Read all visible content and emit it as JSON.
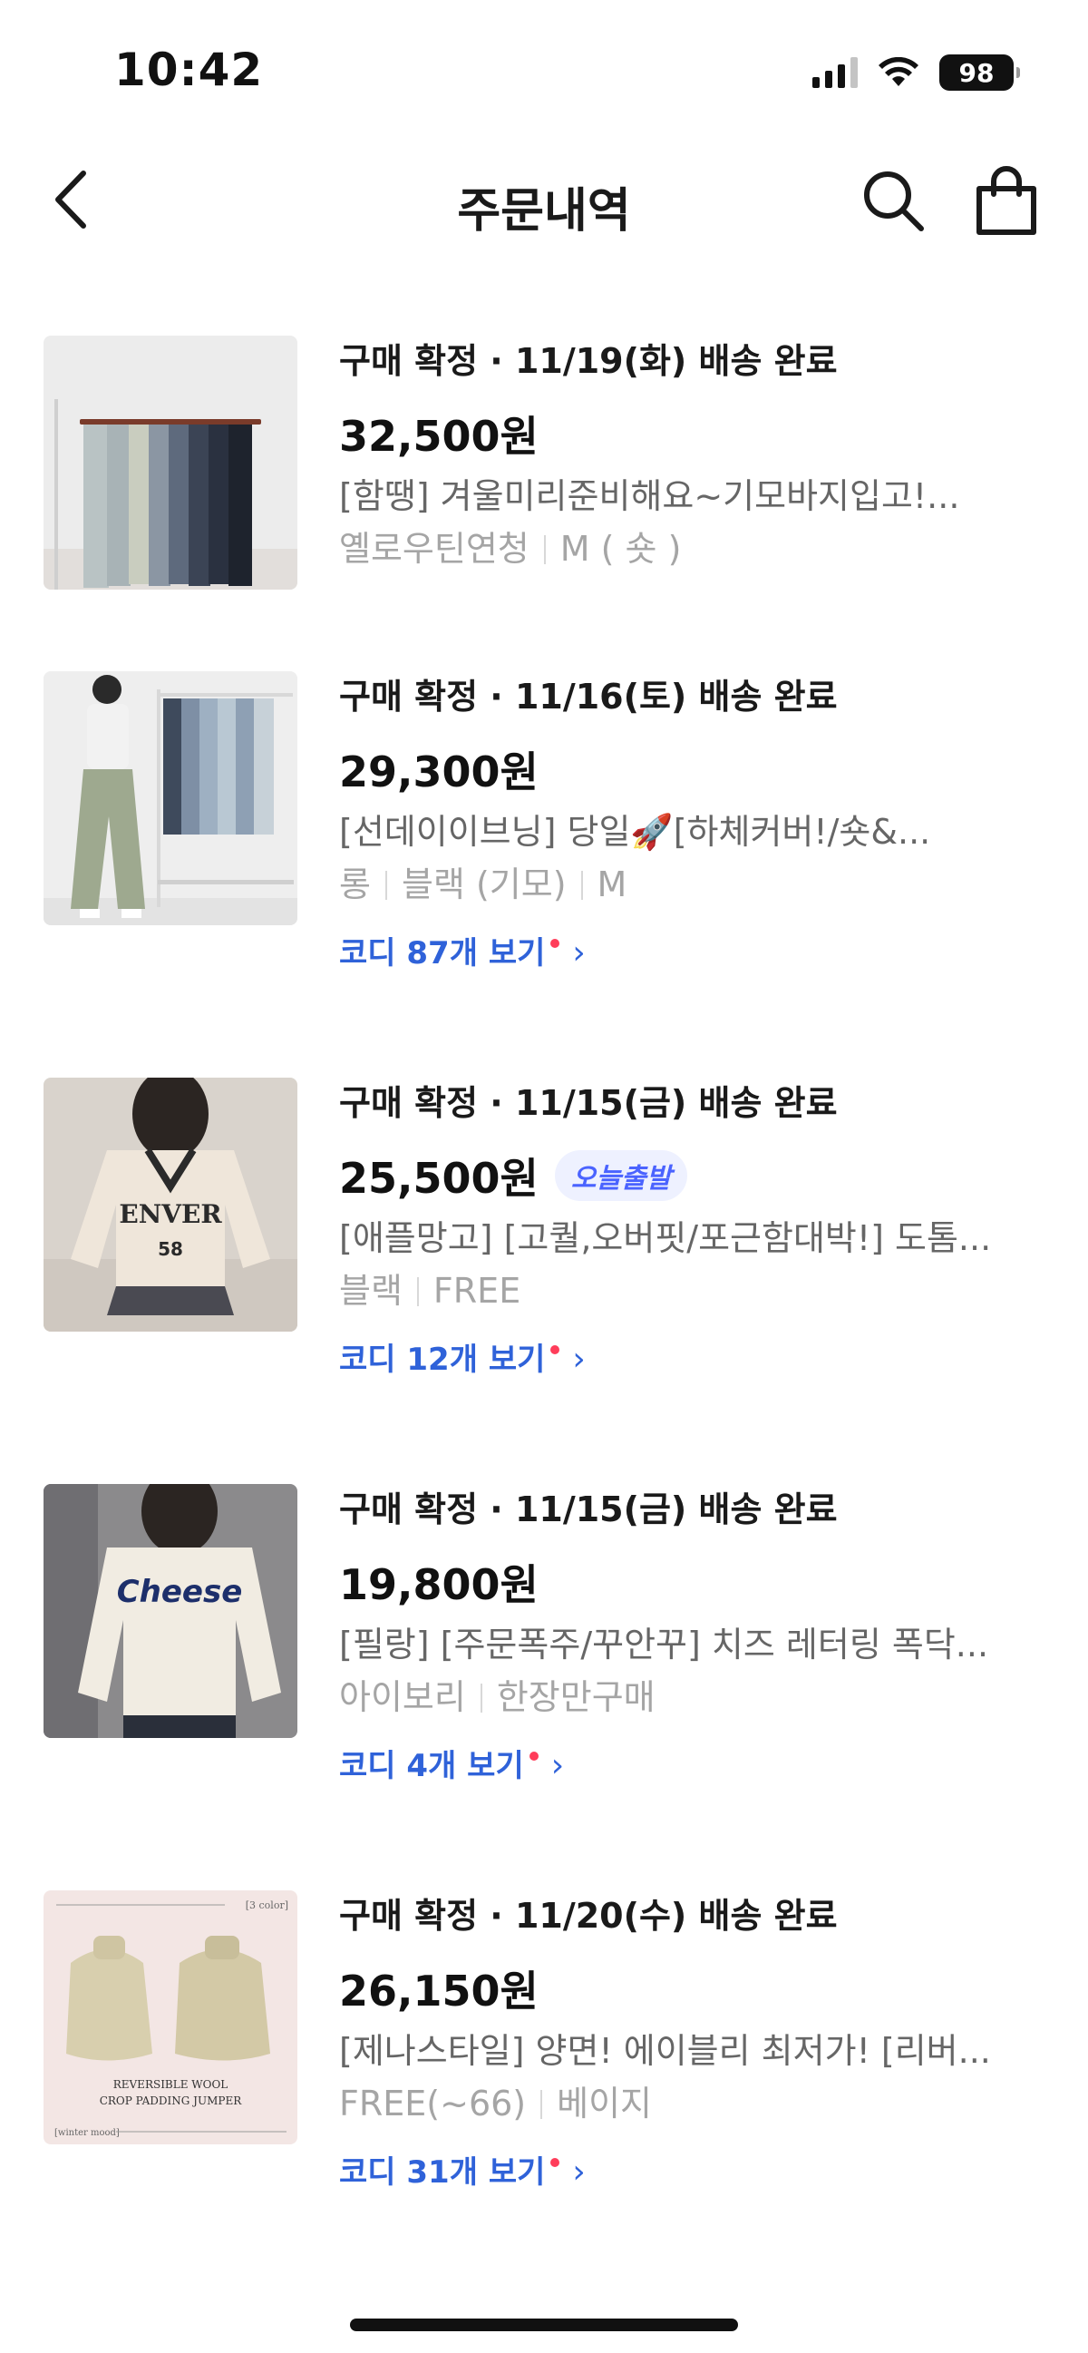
{
  "status_bar": {
    "time": "10:42",
    "battery": "98"
  },
  "nav": {
    "title": "주문내역"
  },
  "orders": [
    {
      "status": "구매 확정 · 11/19(화) 배송 완료",
      "price": "32,500원",
      "badge": "",
      "name": "[함땡] 겨울미리준비해요~기모바지입고!...",
      "options": [
        "옐로우틴연청",
        "M ( 숏 )"
      ],
      "codi": ""
    },
    {
      "status": "구매 확정 · 11/16(토) 배송 완료",
      "price": "29,300원",
      "badge": "",
      "name": "[선데이이브닝] 당일🚀[하체커버!/숏&...",
      "options": [
        "롱",
        "블랙 (기모)",
        "M"
      ],
      "codi": "코디 87개 보기"
    },
    {
      "status": "구매 확정 · 11/15(금) 배송 완료",
      "price": "25,500원",
      "badge": "오늘출발",
      "name": "[애플망고] [고퀄,오버핏/포근함대박!] 도톰...",
      "options": [
        "블랙",
        "FREE"
      ],
      "codi": "코디 12개 보기"
    },
    {
      "status": "구매 확정 · 11/15(금) 배송 완료",
      "price": "19,800원",
      "badge": "",
      "name": "[필랑] [주문폭주/꾸안꾸] 치즈 레터링 폭닥...",
      "options": [
        "아이보리",
        "한장만구매"
      ],
      "codi": "코디 4개 보기"
    },
    {
      "status": "구매 확정 · 11/20(수) 배송 완료",
      "price": "26,150원",
      "badge": "",
      "name": "[제나스타일] 양면! 에이블리 최저가! [리버...",
      "options": [
        "FREE(~66)",
        "베이지"
      ],
      "codi": "코디 31개 보기"
    }
  ],
  "thumb_text": {
    "sweater_print": "Cheese",
    "jersey_print": "ENVER",
    "jersey_number": "58",
    "puffer_color": "[3 color]",
    "puffer_line1": "REVERSIBLE WOOL",
    "puffer_line2": "CROP PADDING JUMPER",
    "puffer_mood": "[winter mood]"
  },
  "colors": {
    "link": "#2f62d9",
    "badge_bg": "#eef1ff",
    "badge_text": "#4a63ff",
    "dot": "#ff3d5a"
  }
}
